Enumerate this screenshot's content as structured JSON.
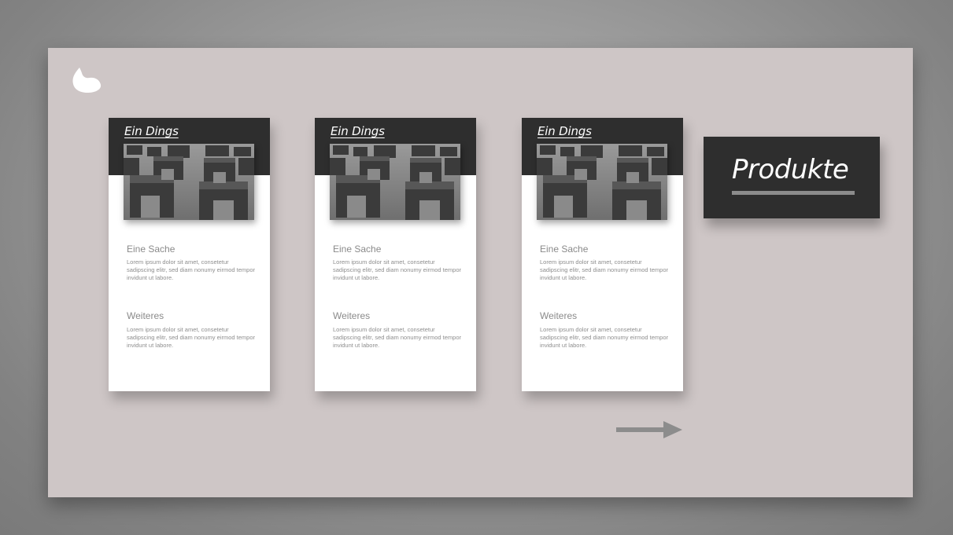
{
  "colors": {
    "frame_background": "#cec6c6",
    "dark_panel": "#2e2e2e",
    "card_background": "#ffffff",
    "muted_text": "#8a8a8a",
    "accent_bar": "#8c8c8c"
  },
  "logo": {
    "icon": "flame-icon"
  },
  "cards": [
    {
      "title": "Ein Dings",
      "image": "concrete-blocks-photo",
      "sections": [
        {
          "heading": "Eine Sache",
          "text": "Lorem ipsum dolor sit amet, consetetur sadipscing elitr, sed diam nonumy eirmod tempor invidunt ut labore."
        },
        {
          "heading": "Weiteres",
          "text": "Lorem ipsum dolor sit amet, consetetur sadipscing elitr, sed diam nonumy eirmod tempor invidunt ut labore."
        }
      ]
    },
    {
      "title": "Ein Dings",
      "image": "concrete-blocks-photo",
      "sections": [
        {
          "heading": "Eine Sache",
          "text": "Lorem ipsum dolor sit amet, consetetur sadipscing elitr, sed diam nonumy eirmod tempor invidunt ut labore."
        },
        {
          "heading": "Weiteres",
          "text": "Lorem ipsum dolor sit amet, consetetur sadipscing elitr, sed diam nonumy eirmod tempor invidunt ut labore."
        }
      ]
    },
    {
      "title": "Ein Dings",
      "image": "concrete-blocks-photo",
      "sections": [
        {
          "heading": "Eine Sache",
          "text": "Lorem ipsum dolor sit amet, consetetur sadipscing elitr, sed diam nonumy eirmod tempor invidunt ut labore."
        },
        {
          "heading": "Weiteres",
          "text": "Lorem ipsum dolor sit amet, consetetur sadipscing elitr, sed diam nonumy eirmod tempor invidunt ut labore."
        }
      ]
    }
  ],
  "section_label": {
    "text": "Produkte"
  },
  "navigation": {
    "next_icon": "arrow-right-icon"
  }
}
